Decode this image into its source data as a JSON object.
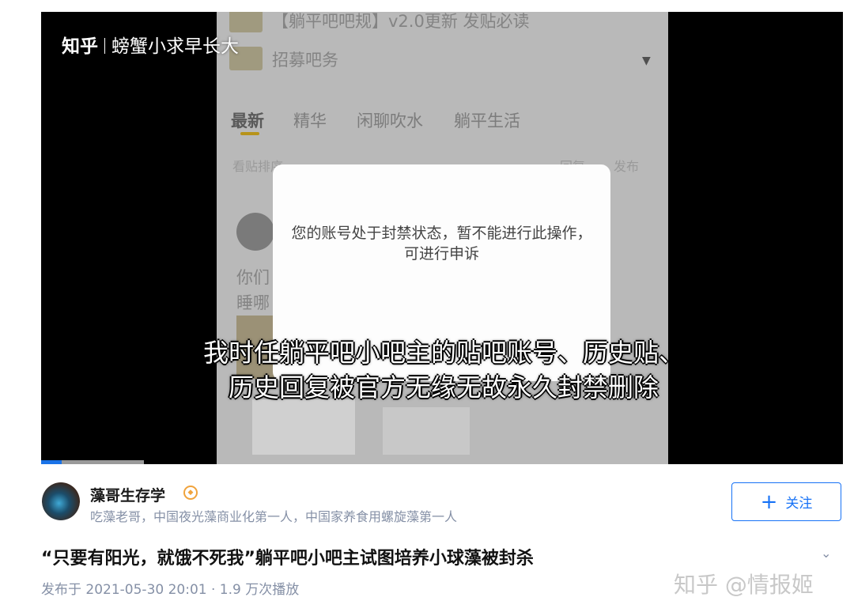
{
  "video": {
    "watermark_brand": "知乎",
    "watermark_author": "螃蟹小求早长大",
    "subtitle": "我时任躺平吧小吧主的贴吧账号、历史贴、历史回复被官方无缘无故永久封禁删除",
    "dialog_message": "您的账号处于封禁状态，暂不能进行此操作，可进行申诉",
    "progress_fraction": 0.2,
    "background_app": {
      "pinned_post": "【躺平吧吧规】v2.0更新 发贴必读",
      "recruit": "招募吧务",
      "tabs": [
        "最新",
        "精华",
        "闲聊吹水",
        "躺平生活"
      ],
      "active_tab": "最新",
      "sort_label": "看贴排序",
      "sort_options": [
        "回复",
        "发布"
      ],
      "post_fragment_1": "你们",
      "post_fragment_2": "睡哪",
      "post_fragment_3": "?"
    }
  },
  "author": {
    "name": "藻哥生存学",
    "description": "吃藻老哥，中国夜光藻商业化第一人，中国家养食用螺旋藻第一人",
    "badge_icon": "certified-badge-icon"
  },
  "follow_button": {
    "label": "关注",
    "icon": "plus-icon",
    "color": "#1772f6"
  },
  "post": {
    "title": "“只要有阳光，就饿不死我”躺平吧小吧主试图培养小球藻被封杀",
    "meta": "发布于 2021-05-30 20:01 · 1.9 万次播放"
  },
  "page_watermark": "知乎 @情报姬",
  "colors": {
    "accent": "#1772f6",
    "meta_text": "#8590a6",
    "badge": "#f0a33c"
  }
}
